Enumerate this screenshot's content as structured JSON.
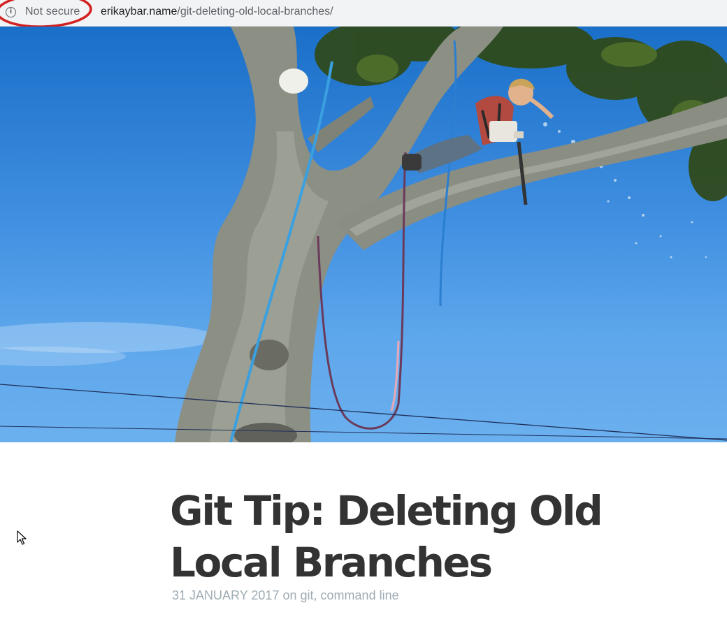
{
  "browser": {
    "security_label": "Not secure",
    "security_icon": "info-icon",
    "url_domain": "erikaybar.name",
    "url_path": "/git-deleting-old-local-branches/",
    "annotation_color": "#d42020"
  },
  "hero_image": {
    "alt": "Person in harness cutting a tree branch with a chainsaw against blue sky"
  },
  "post": {
    "title": "Git Tip: Deleting Old Local Branches",
    "date": "31 JANUARY 2017",
    "on_word": "on",
    "tags": [
      "git",
      "command line"
    ]
  },
  "colors": {
    "title": "#333333",
    "meta": "#9eabb3",
    "sky": "#3f8ee0"
  }
}
